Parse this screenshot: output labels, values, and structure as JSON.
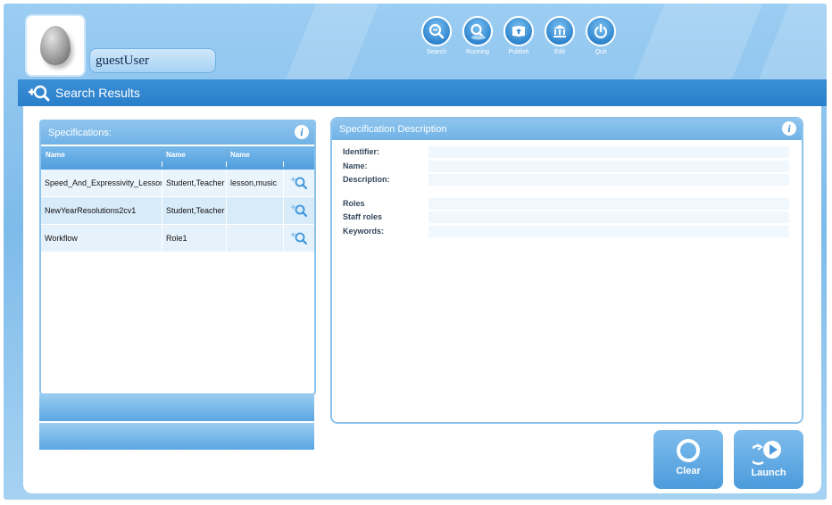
{
  "user": {
    "name": "guestUser"
  },
  "nav": [
    {
      "label": "Search",
      "icon": "search-icon"
    },
    {
      "label": "Running",
      "icon": "running-icon"
    },
    {
      "label": "Publish",
      "icon": "publish-icon"
    },
    {
      "label": "Edit",
      "icon": "edit-icon"
    },
    {
      "label": "Quit",
      "icon": "power-icon"
    }
  ],
  "title": "Search Results",
  "specifications": {
    "header": "Specifications:",
    "columns": [
      "Name",
      "Name",
      "Name"
    ],
    "rows": [
      {
        "name": "Speed_And_Expressivity_Lesson",
        "roles": "Student,Teacher",
        "keywords": "lesson,music"
      },
      {
        "name": "NewYearResolutions2cv1",
        "roles": "Student,Teacher",
        "keywords": ""
      },
      {
        "name": "Workflow",
        "roles": "Role1",
        "keywords": ""
      }
    ]
  },
  "description": {
    "header": "Specification Description",
    "fields": [
      {
        "label": "Identifier:",
        "value": ""
      },
      {
        "label": "Name:",
        "value": ""
      },
      {
        "label": "Description:",
        "value": ""
      },
      {
        "label": "Roles",
        "value": ""
      },
      {
        "label": "Staff roles",
        "value": ""
      },
      {
        "label": "Keywords:",
        "value": ""
      }
    ]
  },
  "actions": {
    "clear_label": "Clear",
    "launch_label": "Launch"
  },
  "colors": {
    "accent": "#2a7fca",
    "panel_border": "#8cc3ec",
    "button": "#4c9bdc"
  }
}
